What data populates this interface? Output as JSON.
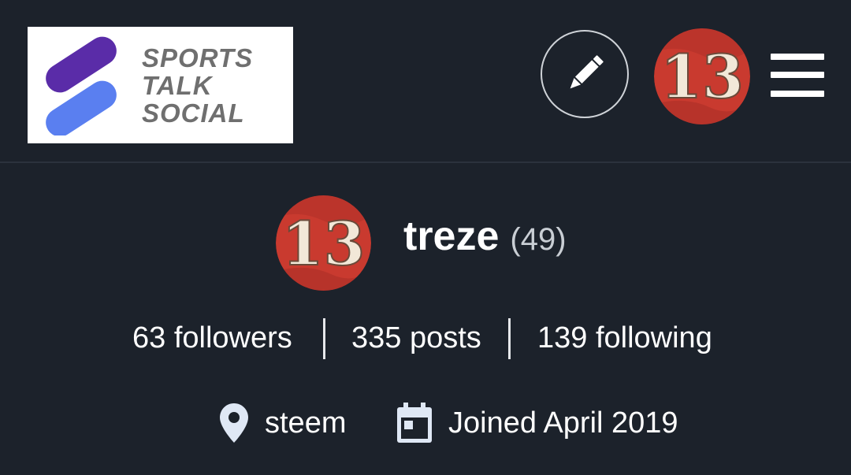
{
  "header": {
    "logo": {
      "lines": [
        "SPORTS",
        "TALK",
        "SOCIAL"
      ],
      "mark_colors": [
        "#5a2ca8",
        "#5a7ff0"
      ]
    },
    "edit_icon": "pencil-icon",
    "avatar_label": "13",
    "menu_icon": "hamburger-menu-icon"
  },
  "profile": {
    "avatar_label": "13",
    "name": "treze",
    "reputation": "(49)"
  },
  "stats": {
    "followers": "63 followers",
    "posts": "335 posts",
    "following": "139 following"
  },
  "meta": {
    "location_icon": "location-pin-icon",
    "location": "steem",
    "joined_icon": "calendar-icon",
    "joined": "Joined April 2019"
  },
  "colors": {
    "background": "#1c222b",
    "text": "#ffffff",
    "muted": "#c9ced4",
    "icon": "#dfe8f5",
    "avatar_red": "#c93a2f"
  }
}
